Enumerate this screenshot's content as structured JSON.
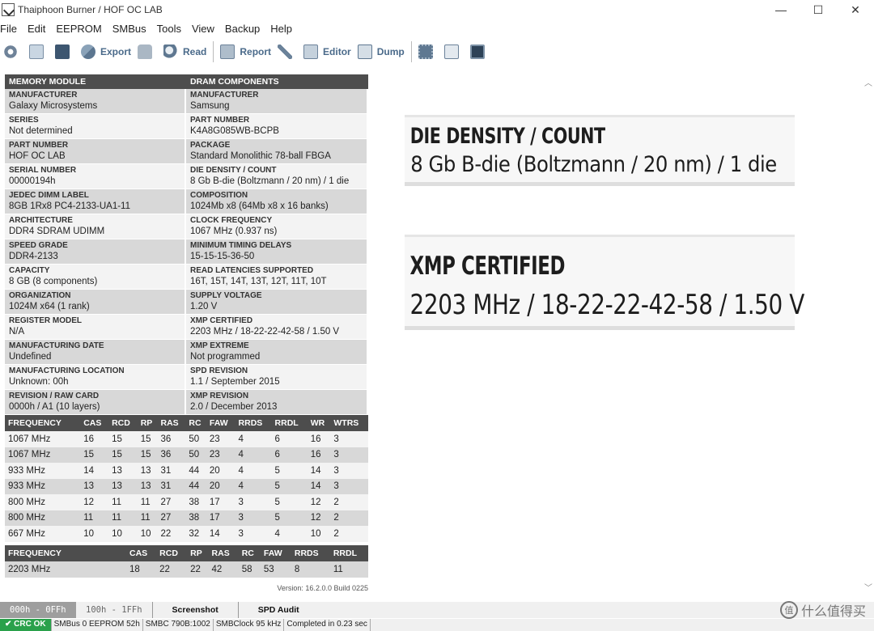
{
  "window": {
    "title": "Thaiphoon Burner / HOF OC LAB",
    "controls": [
      "—",
      "☐",
      "✕"
    ]
  },
  "menu": [
    "File",
    "Edit",
    "EEPROM",
    "SMBus",
    "Tools",
    "View",
    "Backup",
    "Help"
  ],
  "toolbar": {
    "export": "Export",
    "read": "Read",
    "report": "Report",
    "editor": "Editor",
    "dump": "Dump"
  },
  "module": {
    "header": "MEMORY MODULE",
    "fields": [
      {
        "label": "MANUFACTURER",
        "value": "Galaxy Microsystems"
      },
      {
        "label": "SERIES",
        "value": "Not determined"
      },
      {
        "label": "PART NUMBER",
        "value": "HOF OC LAB"
      },
      {
        "label": "SERIAL NUMBER",
        "value": "00000194h"
      },
      {
        "label": "JEDEC DIMM LABEL",
        "value": "8GB 1Rx8 PC4-2133-UA1-11"
      },
      {
        "label": "ARCHITECTURE",
        "value": "DDR4 SDRAM UDIMM"
      },
      {
        "label": "SPEED GRADE",
        "value": "DDR4-2133"
      },
      {
        "label": "CAPACITY",
        "value": "8 GB (8 components)"
      },
      {
        "label": "ORGANIZATION",
        "value": "1024M x64 (1 rank)"
      },
      {
        "label": "REGISTER MODEL",
        "value": "N/A"
      },
      {
        "label": "MANUFACTURING DATE",
        "value": "Undefined"
      },
      {
        "label": "MANUFACTURING LOCATION",
        "value": "Unknown: 00h"
      },
      {
        "label": "REVISION / RAW CARD",
        "value": "0000h / A1 (10 layers)"
      }
    ]
  },
  "dram": {
    "header": "DRAM COMPONENTS",
    "fields": [
      {
        "label": "MANUFACTURER",
        "value": "Samsung"
      },
      {
        "label": "PART NUMBER",
        "value": "K4A8G085WB-BCPB"
      },
      {
        "label": "PACKAGE",
        "value": "Standard Monolithic 78-ball FBGA"
      },
      {
        "label": "DIE DENSITY / COUNT",
        "value": "8 Gb B-die (Boltzmann / 20 nm) / 1 die"
      },
      {
        "label": "COMPOSITION",
        "value": "1024Mb x8 (64Mb x8 x 16 banks)"
      },
      {
        "label": "CLOCK FREQUENCY",
        "value": "1067 MHz (0.937 ns)"
      },
      {
        "label": "MINIMUM TIMING DELAYS",
        "value": "15-15-15-36-50"
      },
      {
        "label": "READ LATENCIES SUPPORTED",
        "value": "16T, 15T, 14T, 13T, 12T, 11T, 10T"
      },
      {
        "label": "SUPPLY VOLTAGE",
        "value": "1.20 V"
      },
      {
        "label": "XMP CERTIFIED",
        "value": "2203 MHz / 18-22-22-42-58 / 1.50 V"
      },
      {
        "label": "XMP EXTREME",
        "value": "Not programmed"
      },
      {
        "label": "SPD REVISION",
        "value": "1.1 / September 2015"
      },
      {
        "label": "XMP REVISION",
        "value": "2.0 / December 2013"
      }
    ]
  },
  "timings": {
    "headers": [
      "FREQUENCY",
      "CAS",
      "RCD",
      "RP",
      "RAS",
      "RC",
      "FAW",
      "RRDS",
      "RRDL",
      "WR",
      "WTRS"
    ],
    "rows": [
      [
        "1067 MHz",
        "16",
        "15",
        "15",
        "36",
        "50",
        "23",
        "4",
        "6",
        "16",
        "3"
      ],
      [
        "1067 MHz",
        "15",
        "15",
        "15",
        "36",
        "50",
        "23",
        "4",
        "6",
        "16",
        "3"
      ],
      [
        "933 MHz",
        "14",
        "13",
        "13",
        "31",
        "44",
        "20",
        "4",
        "5",
        "14",
        "3"
      ],
      [
        "933 MHz",
        "13",
        "13",
        "13",
        "31",
        "44",
        "20",
        "4",
        "5",
        "14",
        "3"
      ],
      [
        "800 MHz",
        "12",
        "11",
        "11",
        "27",
        "38",
        "17",
        "3",
        "5",
        "12",
        "2"
      ],
      [
        "800 MHz",
        "11",
        "11",
        "11",
        "27",
        "38",
        "17",
        "3",
        "5",
        "12",
        "2"
      ],
      [
        "667 MHz",
        "10",
        "10",
        "10",
        "22",
        "32",
        "14",
        "3",
        "4",
        "10",
        "2"
      ]
    ]
  },
  "xmp": {
    "headers": [
      "FREQUENCY",
      "",
      "CAS",
      "RCD",
      "RP",
      "RAS",
      "RC",
      "FAW",
      "RRDS",
      "RRDL"
    ],
    "row": [
      "2203 MHz",
      "",
      "18",
      "22",
      "22",
      "42",
      "58",
      "53",
      "8",
      "11"
    ]
  },
  "version": "Version: 16.2.0.0 Build 0225",
  "zoom1": {
    "title": "DIE DENSITY / COUNT",
    "value": "8 Gb B-die (Boltzmann / 20 nm) / 1 die"
  },
  "zoom2": {
    "title": "XMP CERTIFIED",
    "value": "2203 MHz / 18-22-22-42-58 / 1.50 V"
  },
  "tabs": [
    "000h - 0FFh",
    "100h - 1FFh",
    "Screenshot",
    "SPD Audit"
  ],
  "status": {
    "crc": "CRC OK",
    "smbus": "SMBus 0 EEPROM 52h",
    "smbc": "SMBC 790B:1002",
    "clock": "SMBClock 95 kHz",
    "completed": "Completed in 0.23 sec"
  },
  "watermark": {
    "badge": "值",
    "text": "什么值得买"
  }
}
